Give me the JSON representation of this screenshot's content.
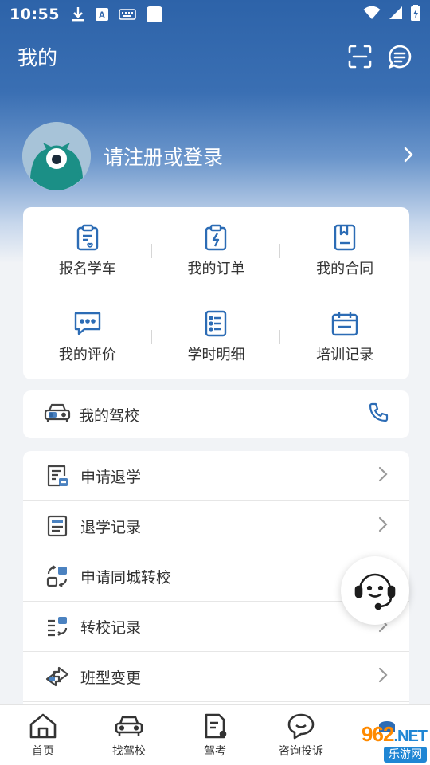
{
  "status_bar": {
    "time": "10:55",
    "icons": [
      "download-icon",
      "text-a-icon",
      "keyboard-icon",
      "square-icon",
      "wifi-icon",
      "signal-icon",
      "battery-charging-icon"
    ]
  },
  "header": {
    "title": "我的",
    "actions": [
      "scan-icon",
      "message-icon"
    ]
  },
  "profile": {
    "login_text": "请注册或登录"
  },
  "grid": [
    {
      "label": "报名学车",
      "icon": "enroll-clipboard-icon"
    },
    {
      "label": "我的订单",
      "icon": "order-icon"
    },
    {
      "label": "我的合同",
      "icon": "contract-icon"
    },
    {
      "label": "我的评价",
      "icon": "review-icon"
    },
    {
      "label": "学时明细",
      "icon": "hours-list-icon"
    },
    {
      "label": "培训记录",
      "icon": "training-calendar-icon"
    }
  ],
  "school": {
    "label": "我的驾校",
    "icon": "car-icon",
    "action_icon": "phone-icon"
  },
  "menu": [
    {
      "label": "申请退学",
      "icon": "withdraw-apply-icon"
    },
    {
      "label": "退学记录",
      "icon": "withdraw-record-icon"
    },
    {
      "label": "申请同城转校",
      "icon": "transfer-apply-icon"
    },
    {
      "label": "转校记录",
      "icon": "transfer-record-icon"
    },
    {
      "label": "班型变更",
      "icon": "class-change-icon"
    }
  ],
  "tabs": [
    {
      "label": "首页",
      "icon": "home-icon"
    },
    {
      "label": "找驾校",
      "icon": "car-icon"
    },
    {
      "label": "驾考",
      "icon": "exam-icon"
    },
    {
      "label": "咨询投诉",
      "icon": "chat-icon"
    },
    {
      "label": "",
      "icon": "profile-icon"
    }
  ],
  "watermark": {
    "top": "962",
    "net": ".NET",
    "bottom": "乐游网"
  },
  "colors": {
    "primary": "#2d63a9",
    "icon_blue": "#2c6cb5",
    "text": "#333333"
  }
}
